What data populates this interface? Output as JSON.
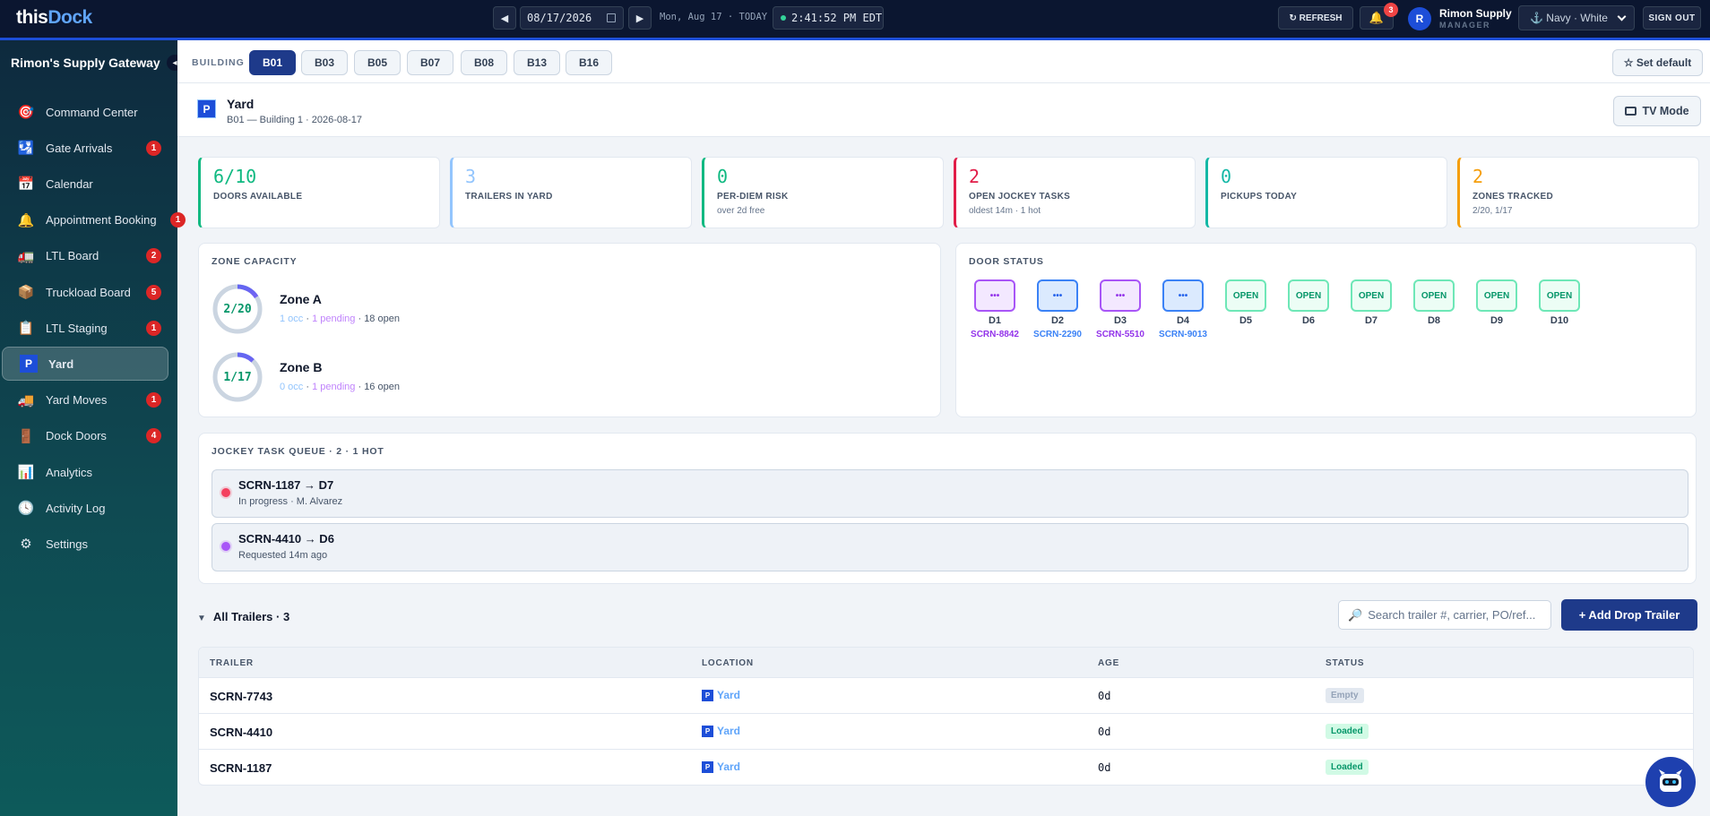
{
  "topbar": {
    "logo_this": "this",
    "logo_dock": "Dock",
    "prev": "◀",
    "next": "▶",
    "date": "08/17/2026",
    "date_label": "Mon, Aug 17 · TODAY",
    "clock": "2:41:52 PM EDT",
    "refresh": "↻ REFRESH",
    "notif_count": "3",
    "avatar": "R",
    "user_name": "Rimon Supply",
    "user_role": "MANAGER",
    "theme": "⚓ Navy · White",
    "signout": "SIGN OUT"
  },
  "sidebar": {
    "title": "Rimon's Supply Gateway",
    "collapse": "◂",
    "items": [
      {
        "icon": "🎯",
        "label": "Command Center",
        "badge": ""
      },
      {
        "icon": "🛂",
        "label": "Gate Arrivals",
        "badge": "1"
      },
      {
        "icon": "📅",
        "label": "Calendar",
        "badge": ""
      },
      {
        "icon": "🔔",
        "label": "Appointment Booking",
        "badge": "1"
      },
      {
        "icon": "🚛",
        "label": "LTL Board",
        "badge": "2"
      },
      {
        "icon": "📦",
        "label": "Truckload Board",
        "badge": "5"
      },
      {
        "icon": "📋",
        "label": "LTL Staging",
        "badge": "1"
      },
      {
        "icon": "P",
        "label": "Yard",
        "badge": ""
      },
      {
        "icon": "🚚",
        "label": "Yard Moves",
        "badge": "1"
      },
      {
        "icon": "🚪",
        "label": "Dock Doors",
        "badge": "4"
      },
      {
        "icon": "📊",
        "label": "Analytics",
        "badge": ""
      },
      {
        "icon": "🕓",
        "label": "Activity Log",
        "badge": ""
      },
      {
        "icon": "⚙",
        "label": "Settings",
        "badge": ""
      }
    ]
  },
  "buildings": {
    "label": "BUILDING",
    "tabs": [
      "B01",
      "B03",
      "B05",
      "B07",
      "B08",
      "B13",
      "B16"
    ],
    "active": "B01",
    "set_default": "☆ Set default"
  },
  "header": {
    "icon": "P",
    "title": "Yard",
    "subtitle": "B01 — Building 1 · 2026-08-17",
    "tv_mode": "TV Mode"
  },
  "stats": [
    {
      "value": "6/10",
      "label": "DOORS AVAILABLE",
      "sub": "",
      "color": "#10b981"
    },
    {
      "value": "3",
      "label": "TRAILERS IN YARD",
      "sub": "",
      "color": "#93c5fd"
    },
    {
      "value": "0",
      "label": "PER-DIEM RISK",
      "sub": "over 2d free",
      "color": "#10b981"
    },
    {
      "value": "2",
      "label": "OPEN JOCKEY TASKS",
      "sub": "oldest 14m · 1 hot",
      "color": "#e11d48"
    },
    {
      "value": "0",
      "label": "PICKUPS TODAY",
      "sub": "",
      "color": "#14b8a6"
    },
    {
      "value": "2",
      "label": "ZONES TRACKED",
      "sub": "2/20, 1/17",
      "color": "#f59e0b"
    }
  ],
  "zone_capacity": {
    "title": "ZONE CAPACITY",
    "zones": [
      {
        "ring": "2/20",
        "name": "Zone A",
        "occ": "1 occ",
        "pending": "1 pending",
        "open": "18 open",
        "fill": 0.1
      },
      {
        "ring": "1/17",
        "name": "Zone B",
        "occ": "0 occ",
        "pending": "1 pending",
        "open": "16 open",
        "fill": 0.06
      }
    ]
  },
  "door_status": {
    "title": "DOOR STATUS",
    "doors": [
      {
        "state": "purple",
        "box": "•••",
        "name": "D1",
        "trailer": "SCRN-8842"
      },
      {
        "state": "blue",
        "box": "•••",
        "name": "D2",
        "trailer": "SCRN-2290"
      },
      {
        "state": "purple",
        "box": "•••",
        "name": "D3",
        "trailer": "SCRN-5510"
      },
      {
        "state": "blue",
        "box": "•••",
        "name": "D4",
        "trailer": "SCRN-9013"
      },
      {
        "state": "open",
        "box": "OPEN",
        "name": "D5",
        "trailer": ""
      },
      {
        "state": "open",
        "box": "OPEN",
        "name": "D6",
        "trailer": ""
      },
      {
        "state": "open",
        "box": "OPEN",
        "name": "D7",
        "trailer": ""
      },
      {
        "state": "open",
        "box": "OPEN",
        "name": "D8",
        "trailer": ""
      },
      {
        "state": "open",
        "box": "OPEN",
        "name": "D9",
        "trailer": ""
      },
      {
        "state": "open",
        "box": "OPEN",
        "name": "D10",
        "trailer": ""
      }
    ]
  },
  "jockey": {
    "title": "JOCKEY TASK QUEUE · 2 · 1 HOT",
    "tasks": [
      {
        "title": "SCRN-1187 → D7",
        "sub": "In progress · M. Alvarez",
        "dot": "#f43f5e"
      },
      {
        "title": "SCRN-4410 → D6",
        "sub": "Requested 14m ago",
        "dot": "#a855f7"
      }
    ]
  },
  "trailers": {
    "caret": "▼",
    "title": "All Trailers · 3",
    "search_placeholder": "Search trailer #, carrier, PO/ref...",
    "add_button": "+ Add Drop Trailer",
    "columns": [
      "TRAILER",
      "LOCATION",
      "AGE",
      "STATUS"
    ],
    "rows": [
      {
        "trailer": "SCRN-7743",
        "loc_icon": "P",
        "location": "Yard",
        "age": "0d",
        "status": "Empty"
      },
      {
        "trailer": "SCRN-4410",
        "loc_icon": "P",
        "location": "Yard",
        "age": "0d",
        "status": "Loaded"
      },
      {
        "trailer": "SCRN-1187",
        "loc_icon": "P",
        "location": "Yard",
        "age": "0d",
        "status": "Loaded"
      }
    ]
  }
}
